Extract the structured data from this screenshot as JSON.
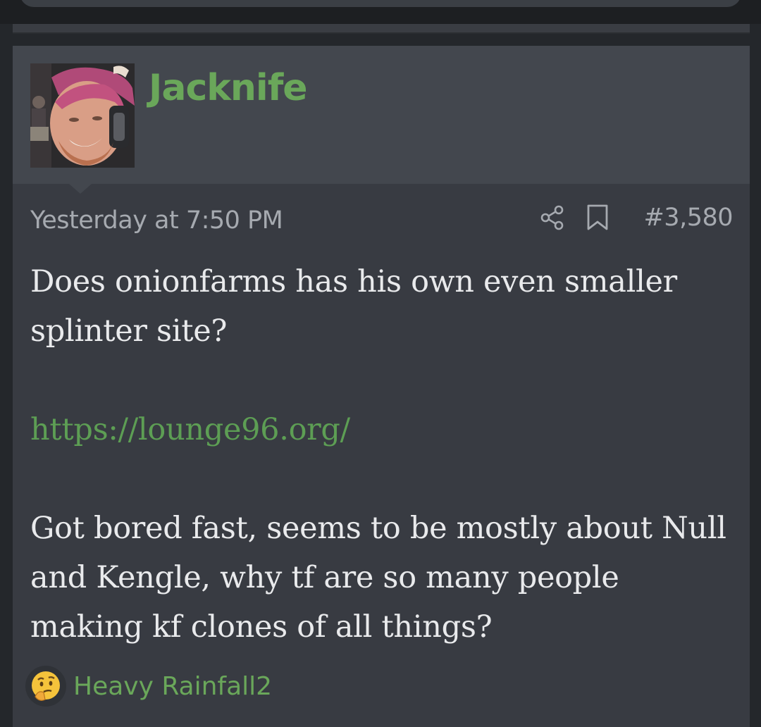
{
  "post": {
    "author": "Jacknife",
    "date": "Yesterday at 7:50 PM",
    "number": "#3,580",
    "paragraphs": [
      "Does onionfarms has his own even smaller splinter site?",
      "https://lounge96.org/",
      "Got bored fast, seems to be mostly about Null and Kengle, why tf are so many people making kf clones of all things?"
    ],
    "reactions": "Heavy Rainfall2"
  },
  "icons": {
    "share": "share-icon",
    "bookmark": "bookmark-icon",
    "reaction": "thinking-face-icon"
  },
  "colors": {
    "accent": "#6aa75a",
    "link": "#5d9e54",
    "text": "#e9eaec",
    "muted": "#a6aab0",
    "post_bg": "#383b42",
    "header_bg": "#43474e"
  }
}
